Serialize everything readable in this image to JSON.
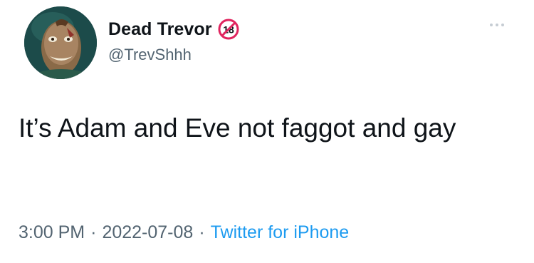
{
  "author": {
    "display_name": "Dead Trevor",
    "handle": "@TrevShhh",
    "badge_icon": "no-under-18-icon",
    "badge_text": "18"
  },
  "tweet": {
    "text": "It’s Adam and Eve not faggot and gay",
    "time": "3:00 PM",
    "date": "2022-07-08",
    "separator": "·",
    "source": "Twitter for iPhone"
  },
  "colors": {
    "text_primary": "#0f1419",
    "text_secondary": "#536471",
    "link": "#1d9bf0",
    "badge_red": "#e0245e"
  }
}
